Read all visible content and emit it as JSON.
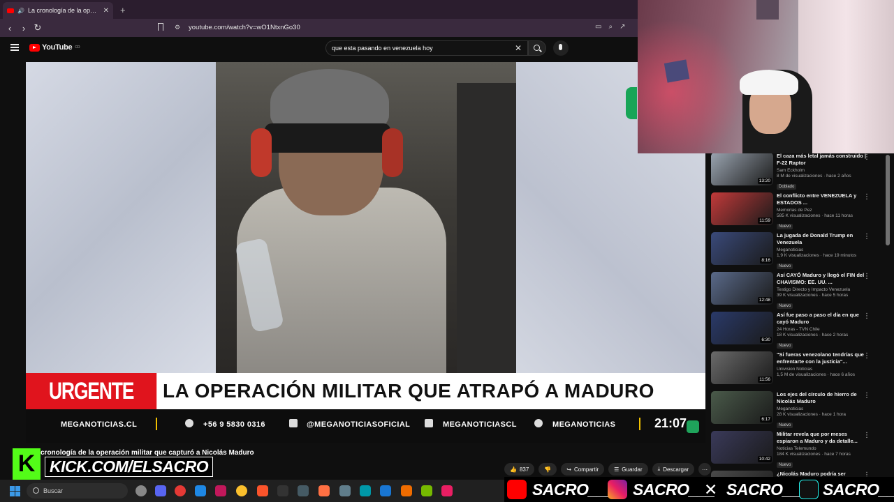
{
  "browser": {
    "tab_title": "La cronología de la operación",
    "new_tab": "+",
    "url": "youtube.com/watch?v=wO1NtxnGo30"
  },
  "youtube": {
    "logo_text": "YouTube",
    "logo_sup": "CO",
    "search_value": "que esta pasando en venezuela hoy"
  },
  "video": {
    "urgente": "URGENTE",
    "headline": "LA OPERACIÓN MILITAR QUE ATRAPÓ A MADURO",
    "ticker": {
      "site": "MEGANOTICIAS.CL",
      "phone": "+56 9 5830 0316",
      "youtube_handle": "@MEGANOTICIASOFICIAL",
      "twitch_handle": "MEGANOTICIASCL",
      "spotify_handle": "MEGANOTICIAS",
      "time": "21:07"
    },
    "title": "cronología de la operación militar que capturó a Nicolás Maduro"
  },
  "actions": {
    "likes": "837",
    "share": "Compartir",
    "save": "Guardar",
    "download": "Descargar",
    "more": "···"
  },
  "overlay": {
    "kick_letter": "K",
    "kick_url": "KICK.COM/ELSACRO"
  },
  "recommendations": [
    {
      "title": "El caza más letal jamás construido | F-22 Raptor",
      "channel": "Sam Eckholm",
      "meta": "8 M de visualizaciones · hace 2 años",
      "badge": "Doblado",
      "duration": "13:20",
      "color": "#9aa4b0"
    },
    {
      "title": "El conflicto entre VENEZUELA y ESTADOS ...",
      "channel": "Memorias de Pez",
      "meta": "585 K visualizaciones · hace 11 horas",
      "badge": "Nuevo",
      "duration": "11:59",
      "color": "#c23a3a"
    },
    {
      "title": "La jugada de Donald Trump en Venezuela",
      "channel": "Meganoticias",
      "meta": "1,9 K visualizaciones · hace 19 minutos",
      "badge": "Nuevo",
      "duration": "8:16",
      "color": "#3a4a7a"
    },
    {
      "title": "Así CAYÓ Maduro y llegó el FIN del CHAVISMO: EE. UU. ...",
      "channel": "Testigo Directo y Impacto Venezuela",
      "meta": "39 K visualizaciones · hace 5 horas",
      "badge": "Nuevo",
      "duration": "12:48",
      "color": "#5a6a8a"
    },
    {
      "title": "Así fue paso a paso el día en que cayó Maduro",
      "channel": "24 Horas - TVN Chile",
      "meta": "18 K visualizaciones · hace 2 horas",
      "badge": "Nuevo",
      "duration": "6:30",
      "color": "#2a3a6a"
    },
    {
      "title": "\"Si fueras venezolano tendrías que enfrentarte con la justicia\"...",
      "channel": "Univision Noticias",
      "meta": "1,5 M de visualizaciones · hace 6 años",
      "badge": "",
      "duration": "11:56",
      "color": "#6a6a6a"
    },
    {
      "title": "Los ejes del círculo de hierro de Nicolás Maduro",
      "channel": "Meganoticias",
      "meta": "28 K visualizaciones · hace 1 hora",
      "badge": "Nuevo",
      "duration": "6:17",
      "color": "#4a5a4a"
    },
    {
      "title": "Militar revela que por meses espiaron a Maduro y da detalle...",
      "channel": "Noticias Telemundo",
      "meta": "184 K visualizaciones · hace 7 horas",
      "badge": "Nuevo",
      "duration": "10:42",
      "color": "#3a3a5a"
    },
    {
      "title": "¿Nicolás Maduro podría ser",
      "channel": "",
      "meta": "",
      "badge": "",
      "duration": "",
      "color": "#4a4a4a"
    }
  ],
  "taskbar": {
    "search_placeholder": "Buscar"
  },
  "socials": {
    "youtube": "SACRO___",
    "instagram": "SACRO___",
    "x": "SACRO___",
    "tiktok": "SACRO___"
  }
}
